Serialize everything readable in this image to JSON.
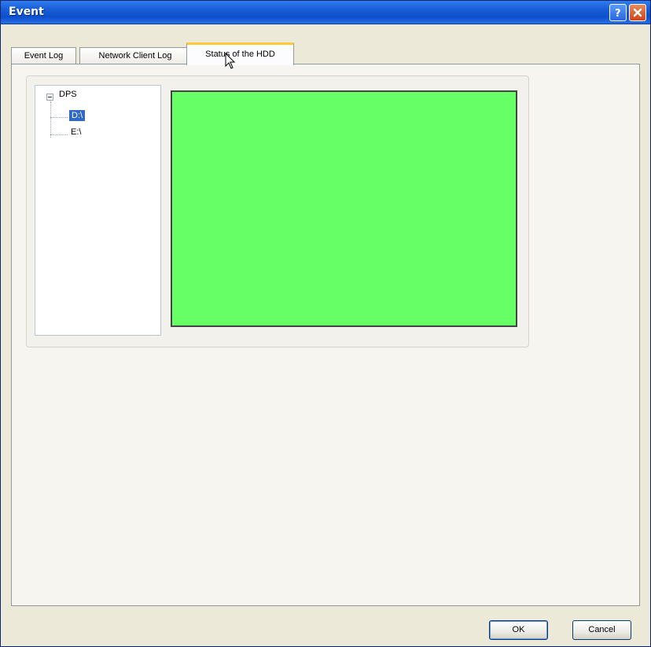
{
  "window": {
    "title": "Event",
    "help_icon": "help-icon",
    "close_icon": "close-icon",
    "titlebar_color": "#0c4fcc"
  },
  "tabs": [
    {
      "label": "Event Log",
      "selected": false
    },
    {
      "label": "Network Client Log",
      "selected": false
    },
    {
      "label": "Status of the HDD",
      "selected": true
    }
  ],
  "tree": {
    "root": {
      "label": "DPS",
      "expanded": true
    },
    "children": [
      {
        "label": "D:\\",
        "selected": true
      },
      {
        "label": "E:\\",
        "selected": false
      }
    ]
  },
  "hdd_status": {
    "color": "#66ff66"
  },
  "buttons": {
    "ok": "OK",
    "cancel": "Cancel"
  }
}
